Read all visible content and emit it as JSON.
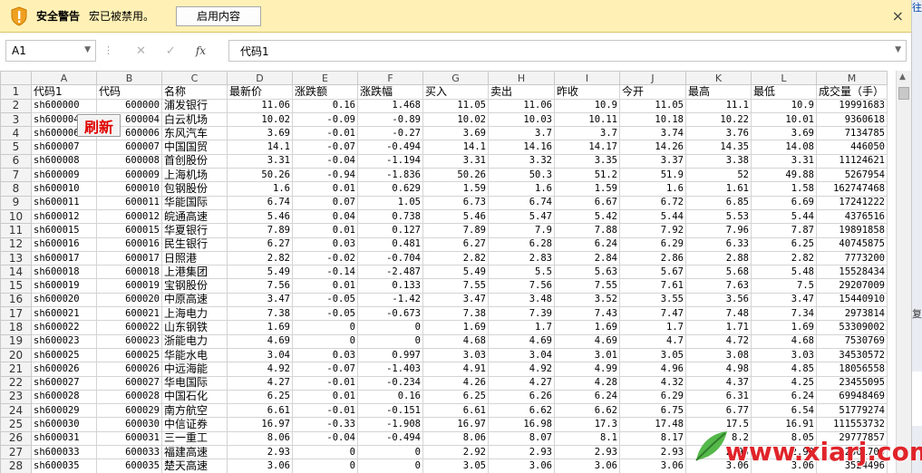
{
  "security_bar": {
    "title": "安全警告",
    "message": "宏已被禁用。",
    "enable_label": "启用内容",
    "close": "×"
  },
  "formula_bar": {
    "cell_ref": "A1",
    "formula": "代码1",
    "fx_label": "fx",
    "cancel": "✕",
    "confirm": "✓"
  },
  "right_strip": {
    "text1": "往",
    "text2": "复"
  },
  "refresh_label": "刷新",
  "watermark": "www.xiarj.com",
  "grid": {
    "columns": [
      "A",
      "B",
      "C",
      "D",
      "E",
      "F",
      "G",
      "H",
      "I",
      "J",
      "K",
      "L",
      "M"
    ],
    "header_row": [
      "代码1",
      "代码",
      "名称",
      "最新价",
      "涨跌额",
      "涨跌幅",
      "买入",
      "卖出",
      "昨收",
      "今开",
      "最高",
      "最低",
      "成交量（手）"
    ],
    "rows": [
      [
        "sh600000",
        "600000",
        "浦发银行",
        "11.06",
        "0.16",
        "1.468",
        "11.05",
        "11.06",
        "10.9",
        "11.05",
        "11.1",
        "10.9",
        "19991683"
      ],
      [
        "sh600004",
        "600004",
        "白云机场",
        "10.02",
        "-0.09",
        "-0.89",
        "10.02",
        "10.03",
        "10.11",
        "10.18",
        "10.22",
        "10.01",
        "9360618"
      ],
      [
        "sh600006",
        "600006",
        "东风汽车",
        "3.69",
        "-0.01",
        "-0.27",
        "3.69",
        "3.7",
        "3.7",
        "3.74",
        "3.76",
        "3.69",
        "7134785"
      ],
      [
        "sh600007",
        "600007",
        "中国国贸",
        "14.1",
        "-0.07",
        "-0.494",
        "14.1",
        "14.16",
        "14.17",
        "14.26",
        "14.35",
        "14.08",
        "446050"
      ],
      [
        "sh600008",
        "600008",
        "首创股份",
        "3.31",
        "-0.04",
        "-1.194",
        "3.31",
        "3.32",
        "3.35",
        "3.37",
        "3.38",
        "3.31",
        "11124621"
      ],
      [
        "sh600009",
        "600009",
        "上海机场",
        "50.26",
        "-0.94",
        "-1.836",
        "50.26",
        "50.3",
        "51.2",
        "51.9",
        "52",
        "49.88",
        "5267954"
      ],
      [
        "sh600010",
        "600010",
        "包钢股份",
        "1.6",
        "0.01",
        "0.629",
        "1.59",
        "1.6",
        "1.59",
        "1.6",
        "1.61",
        "1.58",
        "162747468"
      ],
      [
        "sh600011",
        "600011",
        "华能国际",
        "6.74",
        "0.07",
        "1.05",
        "6.73",
        "6.74",
        "6.67",
        "6.72",
        "6.85",
        "6.69",
        "17241222"
      ],
      [
        "sh600012",
        "600012",
        "皖通高速",
        "5.46",
        "0.04",
        "0.738",
        "5.46",
        "5.47",
        "5.42",
        "5.44",
        "5.53",
        "5.44",
        "4376516"
      ],
      [
        "sh600015",
        "600015",
        "华夏银行",
        "7.89",
        "0.01",
        "0.127",
        "7.89",
        "7.9",
        "7.88",
        "7.92",
        "7.96",
        "7.87",
        "19891858"
      ],
      [
        "sh600016",
        "600016",
        "民生银行",
        "6.27",
        "0.03",
        "0.481",
        "6.27",
        "6.28",
        "6.24",
        "6.29",
        "6.33",
        "6.25",
        "40745875"
      ],
      [
        "sh600017",
        "600017",
        "日照港",
        "2.82",
        "-0.02",
        "-0.704",
        "2.82",
        "2.83",
        "2.84",
        "2.86",
        "2.88",
        "2.82",
        "7773200"
      ],
      [
        "sh600018",
        "600018",
        "上港集团",
        "5.49",
        "-0.14",
        "-2.487",
        "5.49",
        "5.5",
        "5.63",
        "5.67",
        "5.68",
        "5.48",
        "15528434"
      ],
      [
        "sh600019",
        "600019",
        "宝钢股份",
        "7.56",
        "0.01",
        "0.133",
        "7.55",
        "7.56",
        "7.55",
        "7.61",
        "7.63",
        "7.5",
        "29207009"
      ],
      [
        "sh600020",
        "600020",
        "中原高速",
        "3.47",
        "-0.05",
        "-1.42",
        "3.47",
        "3.48",
        "3.52",
        "3.55",
        "3.56",
        "3.47",
        "15440910"
      ],
      [
        "sh600021",
        "600021",
        "上海电力",
        "7.38",
        "-0.05",
        "-0.673",
        "7.38",
        "7.39",
        "7.43",
        "7.47",
        "7.48",
        "7.34",
        "2973814"
      ],
      [
        "sh600022",
        "600022",
        "山东钢铁",
        "1.69",
        "0",
        "0",
        "1.69",
        "1.7",
        "1.69",
        "1.7",
        "1.71",
        "1.69",
        "53309002"
      ],
      [
        "sh600023",
        "600023",
        "浙能电力",
        "4.69",
        "0",
        "0",
        "4.68",
        "4.69",
        "4.69",
        "4.7",
        "4.72",
        "4.68",
        "7530769"
      ],
      [
        "sh600025",
        "600025",
        "华能水电",
        "3.04",
        "0.03",
        "0.997",
        "3.03",
        "3.04",
        "3.01",
        "3.05",
        "3.08",
        "3.03",
        "34530572"
      ],
      [
        "sh600026",
        "600026",
        "中远海能",
        "4.92",
        "-0.07",
        "-1.403",
        "4.91",
        "4.92",
        "4.99",
        "4.96",
        "4.98",
        "4.85",
        "18056558"
      ],
      [
        "sh600027",
        "600027",
        "华电国际",
        "4.27",
        "-0.01",
        "-0.234",
        "4.26",
        "4.27",
        "4.28",
        "4.32",
        "4.37",
        "4.25",
        "23455095"
      ],
      [
        "sh600028",
        "600028",
        "中国石化",
        "6.25",
        "0.01",
        "0.16",
        "6.25",
        "6.26",
        "6.24",
        "6.29",
        "6.31",
        "6.24",
        "69948469"
      ],
      [
        "sh600029",
        "600029",
        "南方航空",
        "6.61",
        "-0.01",
        "-0.151",
        "6.61",
        "6.62",
        "6.62",
        "6.75",
        "6.77",
        "6.54",
        "51779274"
      ],
      [
        "sh600030",
        "600030",
        "中信证券",
        "16.97",
        "-0.33",
        "-1.908",
        "16.97",
        "16.98",
        "17.3",
        "17.48",
        "17.5",
        "16.91",
        "111553732"
      ],
      [
        "sh600031",
        "600031",
        "三一重工",
        "8.06",
        "-0.04",
        "-0.494",
        "8.06",
        "8.07",
        "8.1",
        "8.17",
        "8.2",
        "8.05",
        "29777857"
      ],
      [
        "sh600033",
        "600033",
        "福建高速",
        "2.93",
        "0",
        "0",
        "2.92",
        "2.93",
        "2.93",
        "2.93",
        "2.95",
        "2.92",
        "2501700"
      ],
      [
        "sh600035",
        "600035",
        "楚天高速",
        "3.06",
        "0",
        "0",
        "3.05",
        "3.06",
        "3.06",
        "3.06",
        "3.06",
        "3.06",
        "3524496"
      ]
    ]
  }
}
